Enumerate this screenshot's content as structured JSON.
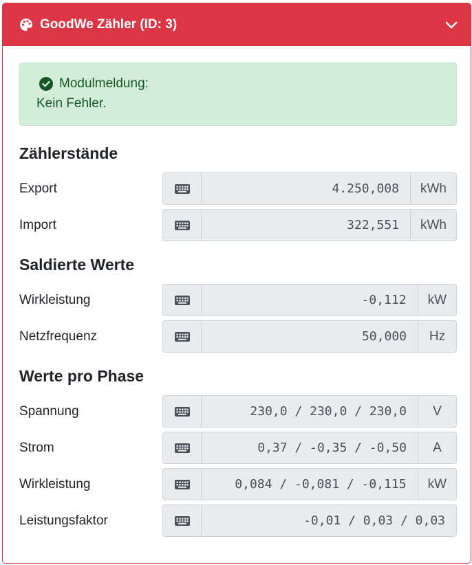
{
  "header": {
    "title": "GoodWe Zähler (ID: 3)",
    "icon": "palette-icon",
    "collapse_icon": "chevron-down-icon",
    "color": "#dc3545"
  },
  "alert": {
    "label": "Modulmeldung:",
    "message": "Kein Fehler.",
    "icon": "check-circle-icon",
    "color": "#155724",
    "background": "#d4edda"
  },
  "sections": [
    {
      "title": "Zählerstände",
      "rows": [
        {
          "label": "Export",
          "value": "4.250,008",
          "unit": "kWh"
        },
        {
          "label": "Import",
          "value": "322,551",
          "unit": "kWh"
        }
      ]
    },
    {
      "title": "Saldierte Werte",
      "rows": [
        {
          "label": "Wirkleistung",
          "value": "-0,112",
          "unit": "kW"
        },
        {
          "label": "Netzfrequenz",
          "value": "50,000",
          "unit": "Hz"
        }
      ]
    },
    {
      "title": "Werte pro Phase",
      "rows": [
        {
          "label": "Spannung",
          "value": "230,0 / 230,0 / 230,0",
          "unit": "V"
        },
        {
          "label": "Strom",
          "value": "0,37 / -0,35 / -0,50",
          "unit": "A"
        },
        {
          "label": "Wirkleistung",
          "value": "0,084 / -0,081 / -0,115",
          "unit": "kW"
        },
        {
          "label": "Leistungsfaktor",
          "value": "-0,01 / 0,03 / 0,03",
          "unit": ""
        }
      ]
    }
  ],
  "row_icon": "keyboard-icon"
}
